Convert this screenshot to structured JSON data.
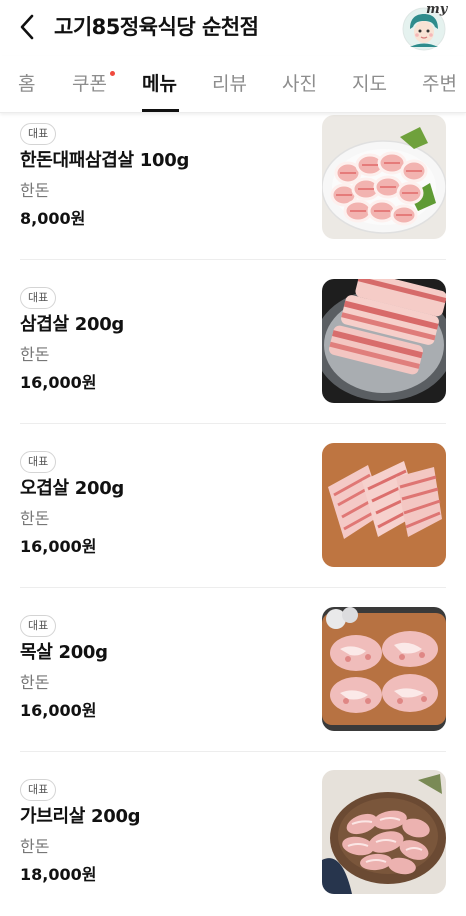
{
  "header": {
    "title": "고기85정육식당 순천점",
    "avatar_label": "my"
  },
  "tabs": [
    {
      "label": "홈",
      "active": false
    },
    {
      "label": "쿠폰",
      "active": false,
      "has_dot": true
    },
    {
      "label": "메뉴",
      "active": true
    },
    {
      "label": "리뷰",
      "active": false
    },
    {
      "label": "사진",
      "active": false
    },
    {
      "label": "지도",
      "active": false
    },
    {
      "label": "주변",
      "active": false
    }
  ],
  "menu": {
    "items": [
      {
        "badge": "대표",
        "name": "한돈대패삼겹살 100g",
        "category": "한돈",
        "price": "8,000원",
        "image": "thin-sliced-pork-belly-photo"
      },
      {
        "badge": "대표",
        "name": "삼겹살 200g",
        "category": "한돈",
        "price": "16,000원",
        "image": "pork-belly-photo"
      },
      {
        "badge": "대표",
        "name": "오겹살 200g",
        "category": "한돈",
        "price": "16,000원",
        "image": "skin-on-pork-belly-photo"
      },
      {
        "badge": "대표",
        "name": "목살 200g",
        "category": "한돈",
        "price": "16,000원",
        "image": "pork-neck-photo"
      },
      {
        "badge": "대표",
        "name": "가브리살 200g",
        "category": "한돈",
        "price": "18,000원",
        "image": "pork-jowl-photo"
      }
    ]
  },
  "colors": {
    "accent_dot": "#f04a3e",
    "active_tab": "#111111",
    "inactive_tab": "#8d8d8d"
  }
}
